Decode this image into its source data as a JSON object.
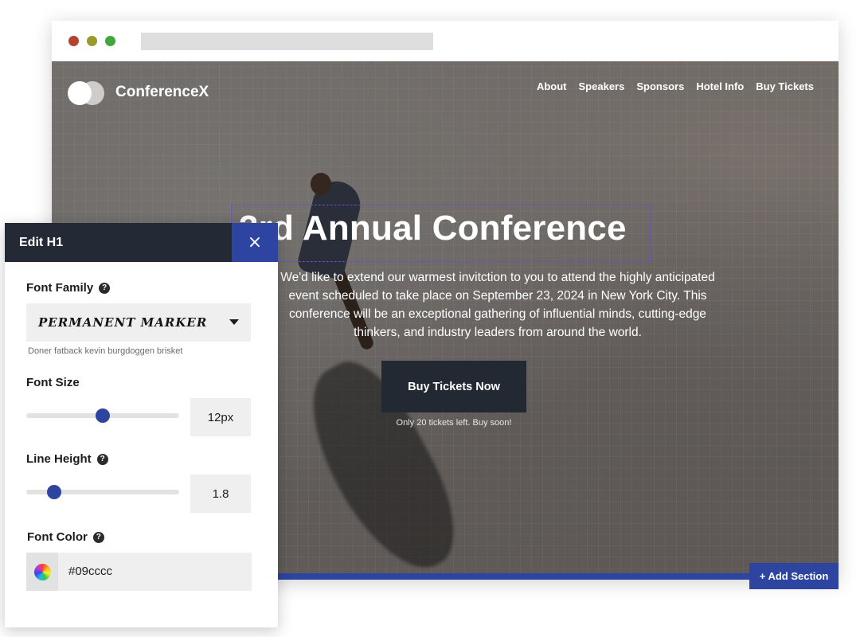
{
  "site": {
    "logo_text": "ConferenceX",
    "nav": [
      "About",
      "Speakers",
      "Sponsors",
      "Hotel Info",
      "Buy Tickets"
    ],
    "headline": "3rd Annual Conference",
    "paragraph": "We'd like to extend our warmest invitction to you to attend the highly anticipated event scheduled to take place on September 23, 2024 in New York City. This conference will be an exceptional gathering of influential minds, cutting-edge thinkers, and industry leaders from around the world.",
    "cta_label": "Buy Tickets Now",
    "cta_note": "Only 20 tickets left. Buy soon!",
    "add_section_label": "+ Add Section"
  },
  "panel": {
    "title": "Edit H1",
    "close_glyph": "×",
    "font_family": {
      "label": "Font Family",
      "value": "Permanent Marker",
      "hint": "Doner fatback kevin burgdoggen brisket"
    },
    "font_size": {
      "label": "Font Size",
      "value": "12px",
      "slider_level": 0.5
    },
    "line_height": {
      "label": "Line Height",
      "value": "1.8",
      "slider_level": 0.15
    },
    "font_color": {
      "label": "Font Color",
      "value": "#09cccc"
    },
    "help_glyph": "?"
  },
  "colors": {
    "accent": "#2d44a0",
    "dark": "#242a35",
    "selection_outline": "#6a4fc9"
  },
  "icons": [
    "close-icon",
    "help-icon",
    "chevron-down-icon",
    "color-wheel-icon"
  ]
}
